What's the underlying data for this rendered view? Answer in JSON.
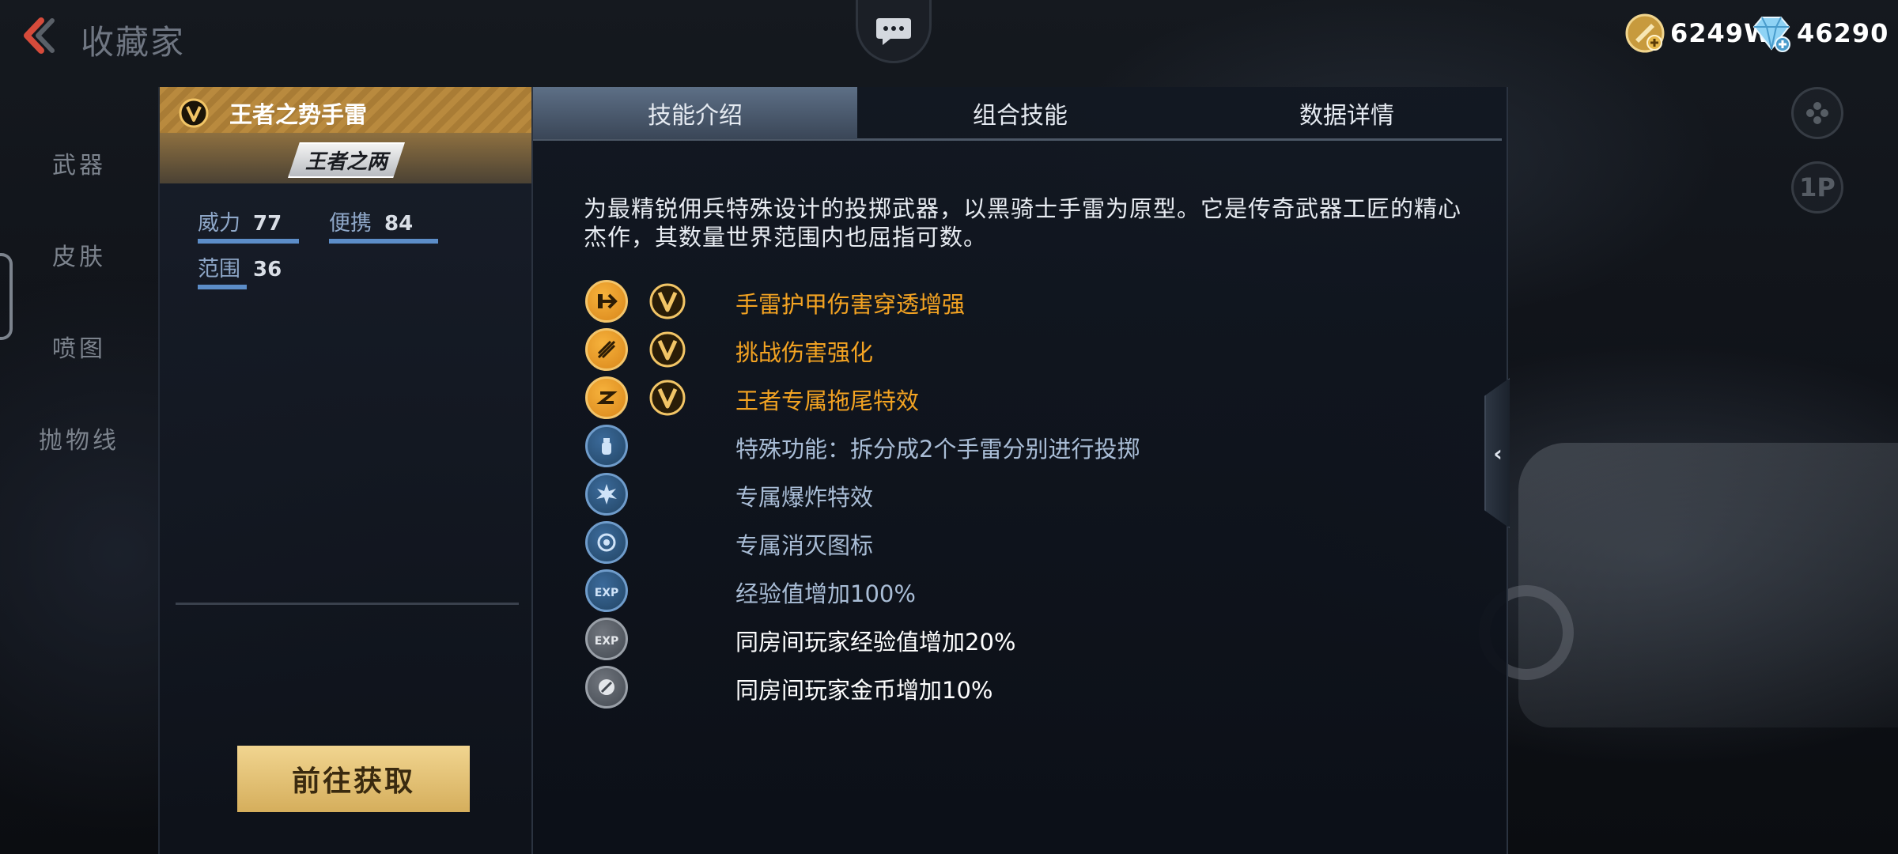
{
  "header": {
    "title": "收藏家",
    "back_icon": "chevron-left-icon",
    "chat_icon": "chat-bubble-icon"
  },
  "currencies": {
    "gold": {
      "icon": "gold-coin-icon",
      "value": "6249W"
    },
    "diamond": {
      "icon": "diamond-icon",
      "value": "46290"
    }
  },
  "side_buttons": {
    "gamepad_icon": "gamepad-icon",
    "oneplayer_label": "1P"
  },
  "nav": {
    "items": [
      {
        "label": "武器"
      },
      {
        "label": "皮肤"
      },
      {
        "label": "喷图"
      },
      {
        "label": "抛物线"
      }
    ]
  },
  "weapon": {
    "name": "王者之势手雷",
    "badge_icon": "v-badge-icon",
    "logo_text": "王者之两",
    "stats": {
      "power": {
        "label": "威力",
        "value": "77"
      },
      "portable": {
        "label": "便携",
        "value": "84"
      },
      "range": {
        "label": "范围",
        "value": "36"
      }
    },
    "acquire_label": "前往获取"
  },
  "tabs": [
    {
      "label": "技能介绍",
      "active": true
    },
    {
      "label": "组合技能",
      "active": false
    },
    {
      "label": "数据详情",
      "active": false
    }
  ],
  "description": "为最精锐佣兵特殊设计的投掷武器，以黑骑士手雷为原型。它是传奇武器工匠的精心杰作，其数量世界范围内也屈指可数。",
  "skills": [
    {
      "icon": "armor-penetration-icon",
      "text": "手雷护甲伤害穿透增强",
      "v_badge": true
    },
    {
      "icon": "challenge-damage-icon",
      "text": "挑战伤害强化",
      "v_badge": true
    },
    {
      "icon": "trail-effect-icon",
      "text": "王者专属拖尾特效",
      "v_badge": true
    },
    {
      "icon": "split-grenade-icon",
      "text": "特殊功能：拆分成2个手雷分别进行投掷",
      "v_badge": false
    },
    {
      "icon": "explosion-effect-icon",
      "text": "专属爆炸特效",
      "v_badge": false
    },
    {
      "icon": "kill-icon-effect-icon",
      "text": "专属消灭图标",
      "v_badge": false
    },
    {
      "icon": "exp-boost-icon",
      "text": "经验值增加100%",
      "v_badge": false
    },
    {
      "icon": "room-exp-boost-icon",
      "text": "同房间玩家经验值增加20%",
      "v_badge": false
    },
    {
      "icon": "room-gold-boost-icon",
      "text": "同房间玩家金币增加10%",
      "v_badge": false
    }
  ],
  "colors": {
    "gold_text": "#f3a322",
    "blue_text": "#a9bdd6",
    "acquire_button": "#e3c17a",
    "active_tab": "#4d5c70"
  }
}
